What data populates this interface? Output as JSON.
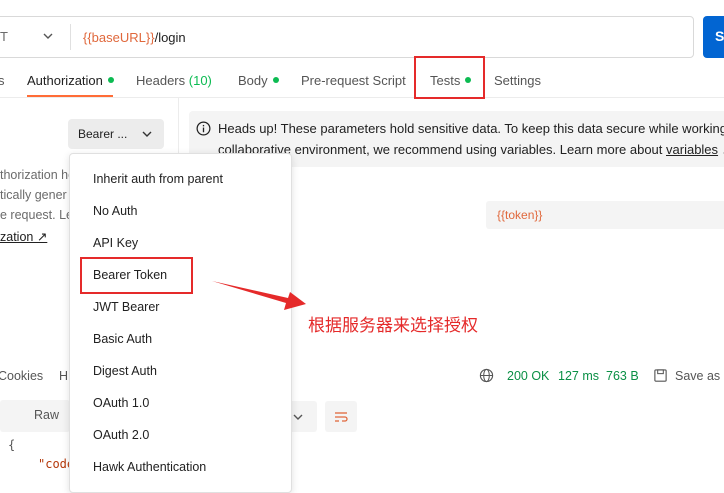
{
  "request": {
    "method": "T",
    "url_var": "{{baseURL}}",
    "url_path": "/login",
    "send_label": "S"
  },
  "tabs": [
    {
      "label": "s"
    },
    {
      "label": "Authorization"
    },
    {
      "label": "Headers",
      "count": "(10)"
    },
    {
      "label": "Body"
    },
    {
      "label": "Pre-request Script"
    },
    {
      "label": "Tests"
    },
    {
      "label": "Settings"
    }
  ],
  "auth": {
    "type_label": "Bearer ...",
    "description_lines": [
      "thorization he",
      "tically gener",
      "e request. Le"
    ],
    "description_link": "zation ↗"
  },
  "banner": {
    "line1": "Heads up! These parameters hold sensitive data. To keep this data secure while working i",
    "line2_prefix": "collaborative environment, we recommend using variables. Learn more about ",
    "line2_link": "variables",
    "line2_suffix": " ↗"
  },
  "token": {
    "value": "{{token}}"
  },
  "menu": {
    "items": [
      "Inherit auth from parent",
      "No Auth",
      "API Key",
      "Bearer Token",
      "JWT Bearer",
      "Basic Auth",
      "Digest Auth",
      "OAuth 1.0",
      "OAuth 2.0",
      "Hawk Authentication"
    ]
  },
  "annotation": {
    "text": "根据服务器来选择授权"
  },
  "response": {
    "cookies_label": "Cookies",
    "h_label": "H",
    "status": "200 OK",
    "time": "127 ms",
    "size": "763 B",
    "save_as": "Save as I",
    "raw_label": "Raw",
    "code_text": "\"code",
    "code_bracket": "{"
  },
  "colors": {
    "accent": "#ff6c37",
    "highlight_red": "#e52a2a",
    "dot_green": "#0cbb52",
    "send_blue": "#0265d2",
    "variable_orange": "#e0683c"
  }
}
